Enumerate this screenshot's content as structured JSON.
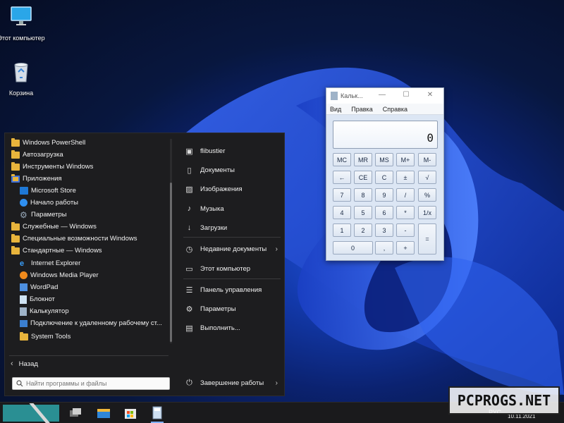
{
  "desktop": {
    "icons": [
      {
        "label": "Этот компьютер",
        "icon": "monitor-icon"
      },
      {
        "label": "Корзина",
        "icon": "recycle-bin-icon"
      }
    ]
  },
  "start_menu": {
    "programs": [
      {
        "label": "Windows PowerShell",
        "icon": "folder-icon"
      },
      {
        "label": "Автозагрузка",
        "icon": "folder-icon"
      },
      {
        "label": "Инструменты Windows",
        "icon": "folder-icon"
      },
      {
        "label": "Приложения",
        "icon": "apps-folder-icon"
      },
      {
        "label": "Microsoft Store",
        "icon": "store-icon"
      },
      {
        "label": "Начало работы",
        "icon": "get-started-icon"
      },
      {
        "label": "Параметры",
        "icon": "settings-gear-icon"
      },
      {
        "label": "Служебные — Windows",
        "icon": "folder-icon"
      },
      {
        "label": "Специальные возможности Windows",
        "icon": "folder-icon"
      },
      {
        "label": "Стандартные — Windows",
        "icon": "folder-icon"
      },
      {
        "label": "Internet Explorer",
        "icon": "internet-explorer-icon"
      },
      {
        "label": "Windows Media Player",
        "icon": "media-player-icon"
      },
      {
        "label": "WordPad",
        "icon": "wordpad-icon"
      },
      {
        "label": "Блокнот",
        "icon": "notepad-icon"
      },
      {
        "label": "Калькулятор",
        "icon": "calculator-icon"
      },
      {
        "label": "Подключение к удаленному рабочему ст...",
        "icon": "remote-desktop-icon"
      },
      {
        "label": "System Tools",
        "icon": "folder-icon"
      }
    ],
    "back_label": "Назад",
    "search_placeholder": "Найти программы и файлы",
    "places": [
      {
        "label": "flibustier",
        "icon": "user-folder-icon"
      },
      {
        "label": "Документы",
        "icon": "document-icon"
      },
      {
        "label": "Изображения",
        "icon": "picture-icon"
      },
      {
        "label": "Музыка",
        "icon": "music-note-icon"
      },
      {
        "label": "Загрузки",
        "icon": "download-icon"
      },
      {
        "label": "Недавние документы",
        "icon": "clock-icon"
      },
      {
        "label": "Этот компьютер",
        "icon": "computer-icon"
      },
      {
        "label": "Панель управления",
        "icon": "control-panel-icon"
      },
      {
        "label": "Параметры",
        "icon": "gear-icon"
      },
      {
        "label": "Выполнить...",
        "icon": "run-icon"
      }
    ],
    "shutdown_label": "Завершение работы"
  },
  "calculator": {
    "title": "Кальк...",
    "menu": [
      "Вид",
      "Правка",
      "Справка"
    ],
    "display": "0",
    "keys": [
      [
        "MC",
        "MR",
        "MS",
        "M+",
        "M-"
      ],
      [
        "←",
        "CE",
        "C",
        "±",
        "√"
      ],
      [
        "7",
        "8",
        "9",
        "/",
        "%"
      ],
      [
        "4",
        "5",
        "6",
        "*",
        "1/x"
      ],
      [
        "1",
        "2",
        "3",
        "-",
        "="
      ],
      [
        "0",
        ",",
        "+"
      ]
    ]
  },
  "taskbar": {
    "language": "РУС",
    "date": "10.11.2021"
  },
  "watermark": "PCPROGS.NET",
  "colors": {
    "start_menu_bg": "#1d1d1f",
    "folder": "#e8b43c",
    "start_button": "#2a8f93",
    "calculator_bg": "#dce6f4"
  }
}
